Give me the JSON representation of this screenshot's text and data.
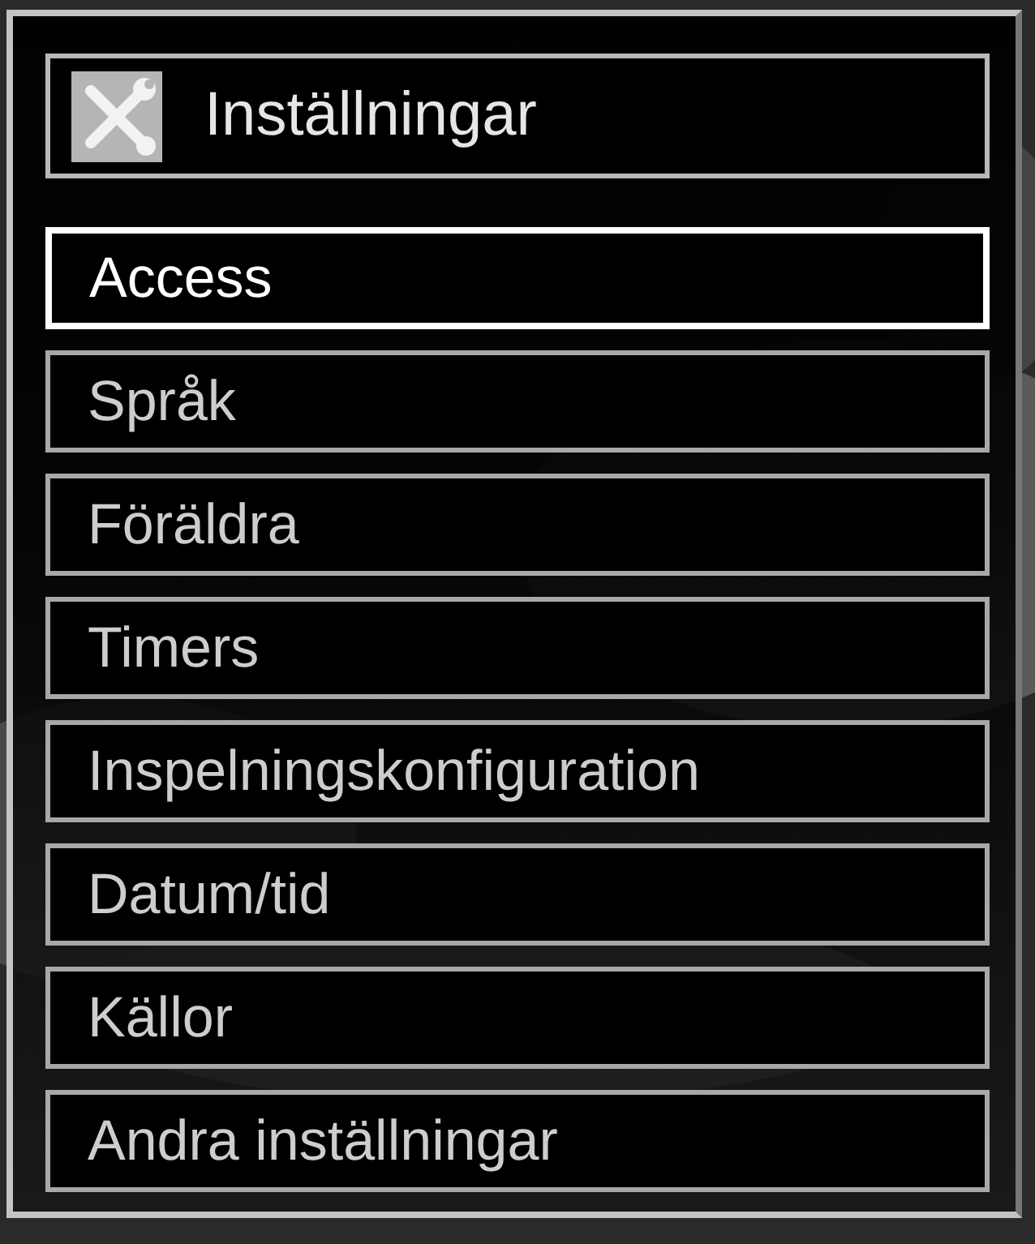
{
  "header": {
    "title": "Inställningar"
  },
  "menu": [
    {
      "label": "Access",
      "selected": true
    },
    {
      "label": "Språk",
      "selected": false
    },
    {
      "label": "Föräldra",
      "selected": false
    },
    {
      "label": "Timers",
      "selected": false
    },
    {
      "label": "Inspelningskonfiguration",
      "selected": false
    },
    {
      "label": "Datum/tid",
      "selected": false
    },
    {
      "label": "Källor",
      "selected": false
    },
    {
      "label": "Andra inställningar",
      "selected": false
    }
  ]
}
